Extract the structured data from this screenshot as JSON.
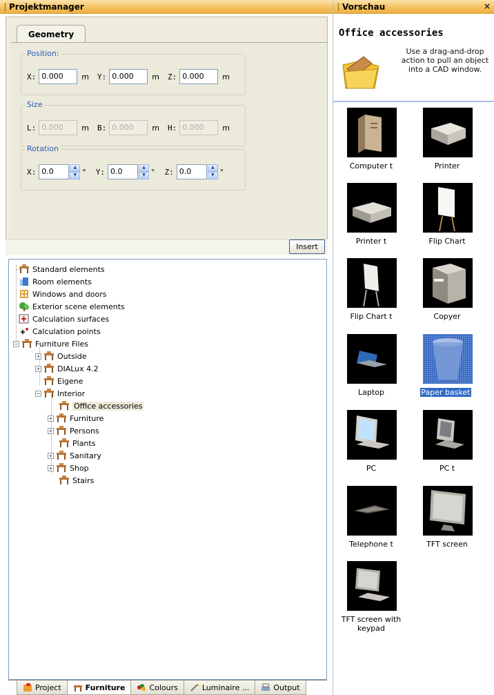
{
  "left_panel": {
    "title": "Projektmanager"
  },
  "geometry": {
    "tab_label": "Geometry",
    "position": {
      "title": "Position:",
      "x_label": "X:",
      "y_label": "Y:",
      "z_label": "Z:",
      "x": "0.000",
      "y": "0.000",
      "z": "0.000",
      "unit": "m"
    },
    "size": {
      "title": "Size",
      "l_label": "L:",
      "b_label": "B:",
      "h_label": "H:",
      "l": "0.000",
      "b": "0.000",
      "h": "0.000",
      "unit": "m"
    },
    "rotation": {
      "title": "Rotation",
      "x_label": "X:",
      "y_label": "Y:",
      "z_label": "Z:",
      "x": "0.0",
      "y": "0.0",
      "z": "0.0",
      "unit": "°"
    },
    "insert_label": "Insert"
  },
  "tree": {
    "nodes": [
      "Standard elements",
      "Room elements",
      "Windows and doors",
      "Exterior scene elements",
      "Calculation surfaces",
      "Calculation points",
      "Furniture Files",
      "Outside",
      "DIALux 4.2",
      "Eigene",
      "Interior",
      "Office accessories",
      "Furniture",
      "Persons",
      "Plants",
      "Sanitary",
      "Shop",
      "Stairs"
    ]
  },
  "bottom_tabs": [
    "Project",
    "Furniture",
    "Colours",
    "Luminaire ...",
    "Output"
  ],
  "right_panel": {
    "title": "Vorschau",
    "close_glyph": "×",
    "category": "Office accessories",
    "hint": "Use a drag-and-drop action to pull an object into a CAD window.",
    "items": [
      "Computer t",
      "Printer",
      "Printer t",
      "Flip Chart",
      "Flip Chart t",
      "Copyer",
      "Laptop",
      "Paper basket",
      "PC",
      "PC t",
      "Telephone t",
      "TFT screen",
      "TFT screen with keypad"
    ],
    "selected_item": "Paper basket"
  },
  "colors": {
    "header": "#f5c15c",
    "selection": "#316ac5",
    "group_title": "#2d5ab4"
  }
}
